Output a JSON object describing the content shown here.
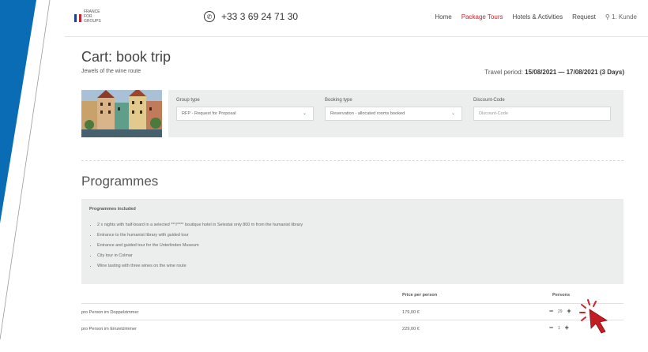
{
  "header": {
    "logo_lines": [
      "FRANCE",
      "FOR",
      "GROUPS"
    ],
    "phone": "+33 3 69 24 71 30",
    "nav": [
      "Home",
      "Package Tours",
      "Hotels & Activities",
      "Request"
    ],
    "user": "1. Kunde"
  },
  "page": {
    "title": "Cart: book trip",
    "subtitle": "Jewels of the wine route",
    "period_label": "Travel period:",
    "period_value": "15/08/2021 — 17/08/2021 (3 Days)"
  },
  "form": {
    "group_type_label": "Group type",
    "group_type_value": "RFP - Request for Proposal",
    "booking_type_label": "Booking type",
    "booking_type_value": "Reservation - allocated rooms booked",
    "discount_label": "Discount-Code",
    "discount_placeholder": "Discount-Code"
  },
  "programmes": {
    "heading": "Programmes",
    "included_title": "Programmes included",
    "items": [
      "2 x nights with half-board in a selected ***/**** boutique hotel in Selestat only 800 m from the humanist library",
      "Entrance to the humanist library with guided tour",
      "Entrance and guided tour for the Unterlinden Museum",
      "City tour in Colmar",
      "Wine tasting with three wines on the wine route"
    ]
  },
  "table": {
    "price_header": "Price per person",
    "persons_header": "Persons",
    "rows": [
      {
        "desc": "pro Person im Doppelzimmer",
        "price": "179,00 €",
        "persons": "29"
      },
      {
        "desc": "pro Person im Einzelzimmer",
        "price": "229,00 €",
        "persons": "1"
      }
    ],
    "minus": "−",
    "plus": "+"
  },
  "colors": {
    "accent_red": "#c8252c",
    "brand_blue": "#0a6cb5"
  }
}
